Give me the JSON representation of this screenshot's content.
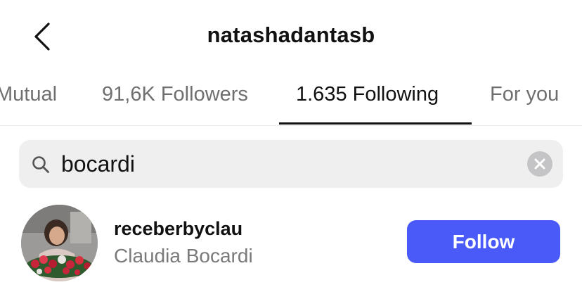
{
  "header": {
    "title": "natashadantasb"
  },
  "tabs": [
    {
      "label": "Mutual",
      "active": false
    },
    {
      "label": "91,6K Followers",
      "active": false
    },
    {
      "label": "1.635 Following",
      "active": true
    },
    {
      "label": "For you",
      "active": false
    }
  ],
  "search": {
    "value": "bocardi",
    "icon": "search-icon",
    "clear_icon": "clear-icon"
  },
  "results": [
    {
      "username": "receberbyclau",
      "full_name": "Claudia Bocardi",
      "button_label": "Follow"
    }
  ],
  "colors": {
    "follow_button": "#4a5af8",
    "active_tab": "#111111",
    "inactive_tab": "#6f6f6f",
    "search_background": "#efefef"
  }
}
